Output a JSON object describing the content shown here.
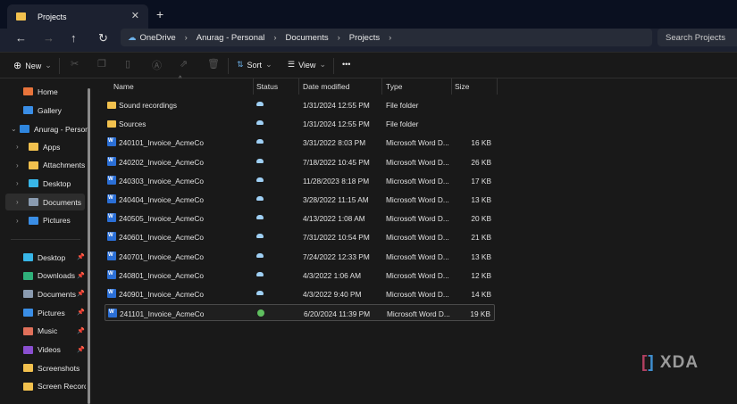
{
  "window": {
    "tab_title": "Projects",
    "close": "✕",
    "new_tab": "+"
  },
  "nav": {
    "back": "←",
    "forward": "→",
    "up": "↑",
    "refresh": "↻",
    "breadcrumb": [
      "OneDrive",
      "Anurag - Personal",
      "Documents",
      "Projects"
    ],
    "search_placeholder": "Search Projects"
  },
  "toolbar": {
    "new": "New",
    "sort": "Sort",
    "view": "View",
    "more": "•••"
  },
  "sidebar": {
    "top": [
      {
        "label": "Home",
        "color": "#e8743b"
      },
      {
        "label": "Gallery",
        "color": "#3a8ee6"
      },
      {
        "label": "Anurag - Person",
        "color": "#2f86de"
      }
    ],
    "tree": [
      {
        "label": "Apps",
        "color": "#f2c14e"
      },
      {
        "label": "Attachments",
        "color": "#f2c14e"
      },
      {
        "label": "Desktop",
        "color": "#38b6e8"
      },
      {
        "label": "Documents",
        "color": "#8a9bb0"
      },
      {
        "label": "Pictures",
        "color": "#3a8ee6"
      }
    ],
    "quick": [
      {
        "label": "Desktop",
        "color": "#38b6e8",
        "pinned": true
      },
      {
        "label": "Downloads",
        "color": "#2fb07a",
        "pinned": true
      },
      {
        "label": "Documents",
        "color": "#8a9bb0",
        "pinned": true
      },
      {
        "label": "Pictures",
        "color": "#3a8ee6",
        "pinned": true
      },
      {
        "label": "Music",
        "color": "#e0705a",
        "pinned": true
      },
      {
        "label": "Videos",
        "color": "#8a4fd0",
        "pinned": true
      },
      {
        "label": "Screenshots",
        "color": "#f2c14e",
        "pinned": false
      },
      {
        "label": "Screen Recordin",
        "color": "#f2c14e",
        "pinned": false
      }
    ]
  },
  "columns": [
    "Name",
    "Status",
    "Date modified",
    "Type",
    "Size"
  ],
  "files": [
    {
      "name": "Sound recordings",
      "kind": "folder",
      "status": "cloud",
      "date": "1/31/2024 12:55 PM",
      "type": "File folder",
      "size": ""
    },
    {
      "name": "Sources",
      "kind": "folder",
      "status": "cloud",
      "date": "1/31/2024 12:55 PM",
      "type": "File folder",
      "size": ""
    },
    {
      "name": "240101_Invoice_AcmeCo",
      "kind": "doc",
      "status": "cloud",
      "date": "3/31/2022 8:03 PM",
      "type": "Microsoft Word D...",
      "size": "16 KB"
    },
    {
      "name": "240202_Invoice_AcmeCo",
      "kind": "doc",
      "status": "cloud",
      "date": "7/18/2022 10:45 PM",
      "type": "Microsoft Word D...",
      "size": "26 KB"
    },
    {
      "name": "240303_Invoice_AcmeCo",
      "kind": "doc",
      "status": "cloud",
      "date": "11/28/2023 8:18 PM",
      "type": "Microsoft Word D...",
      "size": "17 KB"
    },
    {
      "name": "240404_Invoice_AcmeCo",
      "kind": "doc",
      "status": "cloud",
      "date": "3/28/2022 11:15 AM",
      "type": "Microsoft Word D...",
      "size": "13 KB"
    },
    {
      "name": "240505_Invoice_AcmeCo",
      "kind": "doc",
      "status": "cloud",
      "date": "4/13/2022 1:08 AM",
      "type": "Microsoft Word D...",
      "size": "20 KB"
    },
    {
      "name": "240601_Invoice_AcmeCo",
      "kind": "doc",
      "status": "cloud",
      "date": "7/31/2022 10:54 PM",
      "type": "Microsoft Word D...",
      "size": "21 KB"
    },
    {
      "name": "240701_Invoice_AcmeCo",
      "kind": "doc",
      "status": "cloud",
      "date": "7/24/2022 12:33 PM",
      "type": "Microsoft Word D...",
      "size": "13 KB"
    },
    {
      "name": "240801_Invoice_AcmeCo",
      "kind": "doc",
      "status": "cloud",
      "date": "4/3/2022 1:06 AM",
      "type": "Microsoft Word D...",
      "size": "12 KB"
    },
    {
      "name": "240901_Invoice_AcmeCo",
      "kind": "doc",
      "status": "cloud",
      "date": "4/3/2022 9:40 PM",
      "type": "Microsoft Word D...",
      "size": "14 KB"
    },
    {
      "name": "241101_Invoice_AcmeCo",
      "kind": "doc",
      "status": "synced",
      "date": "6/20/2024 11:39 PM",
      "type": "Microsoft Word D...",
      "size": "19 KB"
    }
  ],
  "watermark": "XDA"
}
